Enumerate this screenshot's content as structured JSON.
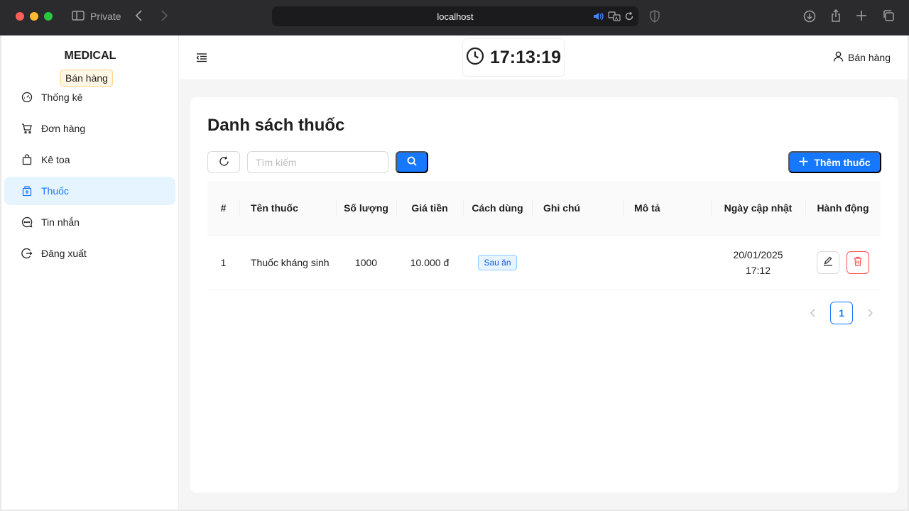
{
  "browser": {
    "mode_label": "Private",
    "url": "localhost",
    "icons": [
      "sidebar-icon",
      "back-icon",
      "forward-icon",
      "audio-icon",
      "translate-icon",
      "reload-icon",
      "shield-icon",
      "download-icon",
      "share-icon",
      "new-tab-icon",
      "tabs-overview-icon"
    ]
  },
  "sidebar": {
    "brand": "MEDICAL",
    "role": "Bán hàng",
    "items": [
      {
        "label": "Thống kê",
        "icon": "dashboard-icon"
      },
      {
        "label": "Đơn hàng",
        "icon": "cart-icon"
      },
      {
        "label": "Kê toa",
        "icon": "shopping-bag-icon"
      },
      {
        "label": "Thuốc",
        "icon": "medicine-box-icon",
        "active": true
      },
      {
        "label": "Tin nhắn",
        "icon": "message-icon"
      },
      {
        "label": "Đăng xuất",
        "icon": "logout-icon"
      }
    ]
  },
  "header": {
    "clock": "17:13:19",
    "user": "Bán hàng"
  },
  "main": {
    "title": "Danh sách thuốc",
    "search_placeholder": "Tìm kiếm",
    "add_label": "Thêm thuốc",
    "columns": [
      "#",
      "Tên thuốc",
      "Số lượng",
      "Giá tiền",
      "Cách dùng",
      "Ghi chú",
      "Mô tả",
      "Ngày cập nhật",
      "Hành động"
    ],
    "rows": [
      {
        "index": "1",
        "name": "Thuốc kháng sinh",
        "quantity": "1000",
        "price": "10.000 đ",
        "usage": "Sau ăn",
        "note": "",
        "description": "",
        "updated": "20/01/2025 17:12"
      }
    ],
    "pagination": {
      "current": "1"
    }
  },
  "colors": {
    "primary": "#1677ff",
    "active_bg": "#e6f4ff",
    "danger": "#ff4d4f"
  }
}
